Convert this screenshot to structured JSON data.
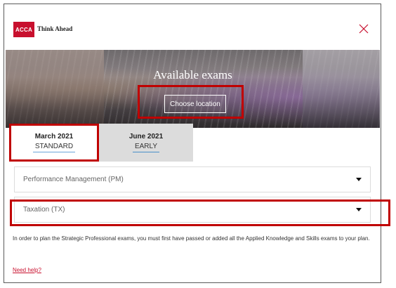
{
  "header": {
    "logo_text": "ACCA",
    "tagline": "Think Ahead",
    "close_icon": "close-x-icon",
    "accent_color": "#c8102e"
  },
  "hero": {
    "title": "Available exams",
    "choose_location_label": "Choose location"
  },
  "tabs": [
    {
      "month": "March 2021",
      "type": "STANDARD",
      "active": true
    },
    {
      "month": "June 2021",
      "type": "EARLY",
      "active": false
    }
  ],
  "exams": [
    {
      "label": "Performance Management (PM)"
    },
    {
      "label": "Taxation (TX)"
    }
  ],
  "info_text": "In order to plan the Strategic Professional exams, you must first have passed or added all the Applied Knowledge and Skills exams to your plan.",
  "help_link": "Need help?",
  "highlight_color": "#c00000"
}
